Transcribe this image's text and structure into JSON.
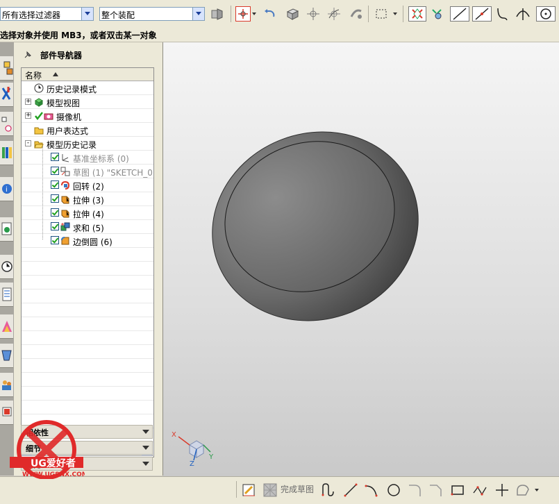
{
  "toolbar": {
    "filter_select": "所有选择过滤器",
    "scope_select": "整个装配"
  },
  "cue_line": "选择对象并使用 MB3，或者双击某一对象",
  "navigator": {
    "title": "部件导航器",
    "column_header": "名称",
    "items": [
      {
        "label": "历史记录模式",
        "icon": "clock-icon",
        "expander": ""
      },
      {
        "label": "模型视图",
        "icon": "model-view-icon",
        "expander": "+"
      },
      {
        "label": "摄像机",
        "icon": "camera-icon",
        "expander": "+",
        "checked": true
      },
      {
        "label": "用户表达式",
        "icon": "folder-icon",
        "expander": ""
      },
      {
        "label": "模型历史记录",
        "icon": "folder-open-icon",
        "expander": "-"
      }
    ],
    "features": [
      {
        "label": "基准坐标系 (0)",
        "icon": "datum-csys-icon",
        "dim": true
      },
      {
        "label": "草图 (1) \"SKETCH_0...",
        "icon": "sketch-icon",
        "dim": true
      },
      {
        "label": "回转 (2)",
        "icon": "revolve-icon",
        "dim": false
      },
      {
        "label": "拉伸 (3)",
        "icon": "extrude-icon",
        "dim": false
      },
      {
        "label": "拉伸 (4)",
        "icon": "extrude-icon",
        "dim": false
      },
      {
        "label": "求和 (5)",
        "icon": "unite-icon",
        "dim": false
      },
      {
        "label": "边倒圆 (6)",
        "icon": "edge-blend-icon",
        "dim": false
      }
    ],
    "panels": [
      "相依性",
      "细节",
      "预览"
    ]
  },
  "bottombar": {
    "finish_sketch_label": "完成草图"
  },
  "triad_labels": {
    "x": "X",
    "y": "Y",
    "z": "Z"
  },
  "watermark": {
    "text": "UG爱好者",
    "url": "WWW.UGSNX.COM"
  },
  "colors": {
    "check_green": "#21a121",
    "folder_yellow": "#f4c542",
    "snap_red": "#d93a2b"
  }
}
